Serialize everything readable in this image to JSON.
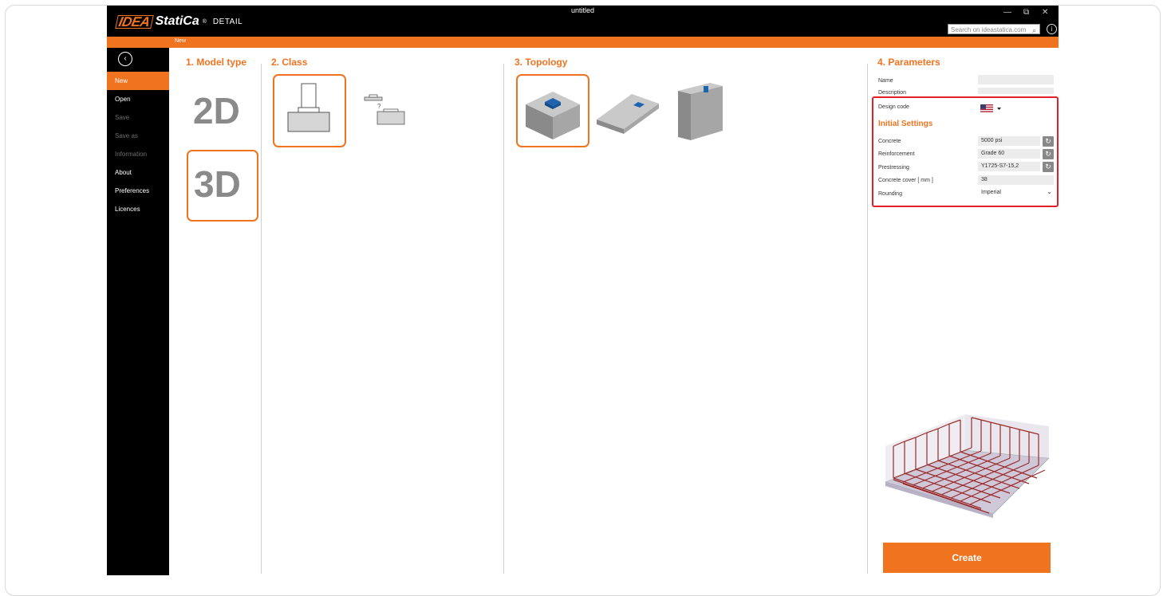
{
  "window": {
    "title": "untitled",
    "logo_text": "IDEA",
    "product_text": "StatiCa",
    "module_text": "DETAIL",
    "search_placeholder": "Search on ideastatica.com",
    "minimize": "—",
    "restore": "⧉",
    "close": "✕"
  },
  "breadcrumb": "New",
  "sidebar": {
    "items": [
      {
        "label": "New",
        "state": "active"
      },
      {
        "label": "Open",
        "state": "normal"
      },
      {
        "label": "Save",
        "state": "disabled"
      },
      {
        "label": "Save as",
        "state": "disabled"
      },
      {
        "label": "Information",
        "state": "disabled"
      },
      {
        "label": "About",
        "state": "normal"
      },
      {
        "label": "Preferences",
        "state": "normal"
      },
      {
        "label": "Licences",
        "state": "normal"
      }
    ]
  },
  "steps": {
    "model_type": "1. Model type",
    "class": "2. Class",
    "topology": "3. Topology",
    "parameters": "4. Parameters"
  },
  "model_types": [
    "2D",
    "3D"
  ],
  "parameters": {
    "name_label": "Name",
    "description_label": "Description",
    "design_code_label": "Design code",
    "initial_settings": "Initial Settings",
    "concrete_label": "Concrete",
    "concrete_value": "5000 psi",
    "reinforcement_label": "Reinforcement",
    "reinforcement_value": "Grade 60",
    "prestressing_label": "Prestressing",
    "prestressing_value": "Y1725-S7-15,2",
    "cover_label": "Concrete cover  [ mm ]",
    "cover_value": "38",
    "rounding_label": "Rounding",
    "rounding_value": "Imperial"
  },
  "create_label": "Create",
  "colors": {
    "accent": "#f07320",
    "highlight": "#e3202a",
    "sidebar": "#000000"
  }
}
